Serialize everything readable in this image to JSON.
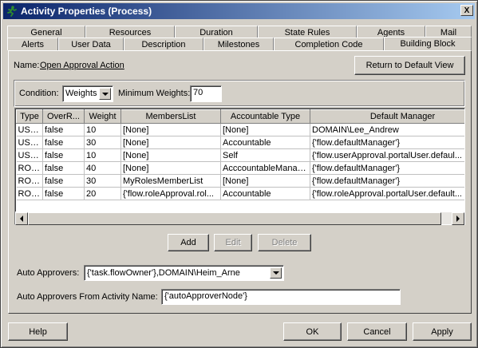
{
  "window": {
    "title": "Activity Properties (Process)",
    "close_glyph": "X"
  },
  "tabs_row1": [
    {
      "label": "General"
    },
    {
      "label": "Resources"
    },
    {
      "label": "Duration"
    },
    {
      "label": "State Rules"
    },
    {
      "label": "Agents"
    },
    {
      "label": "Mail"
    }
  ],
  "tabs_row2": [
    {
      "label": "Alerts"
    },
    {
      "label": "User Data"
    },
    {
      "label": "Description"
    },
    {
      "label": "Milestones"
    },
    {
      "label": "Completion Code"
    },
    {
      "label": "Building Block"
    }
  ],
  "name_label": "Name:",
  "name_value": "Open Approval Action",
  "return_button": "Return to Default View",
  "condition_label": "Condition:",
  "condition_value": "Weights",
  "min_weights_label": "Minimum Weights:",
  "min_weights_value": "70",
  "table": {
    "columns": [
      "Type",
      "OverR...",
      "Weight",
      "MembersList",
      "Accountable Type",
      "Default Manager"
    ],
    "rows": [
      [
        "USER",
        "false",
        "10",
        "[None]",
        "[None]",
        "DOMAIN\\Lee_Andrew"
      ],
      [
        "USER",
        "false",
        "30",
        "[None]",
        "Accountable",
        "{'flow.defaultManager'}"
      ],
      [
        "USER",
        "false",
        "10",
        "[None]",
        "Self",
        "{'flow.userApproval.portalUser.defaul..."
      ],
      [
        "ROLE",
        "false",
        "40",
        "[None]",
        "AcccountableManager",
        "{'flow.defaultManager'}"
      ],
      [
        "ROLE",
        "false",
        "30",
        "MyRolesMemberList",
        "[None]",
        "{'flow.defaultManager'}"
      ],
      [
        "ROLE",
        "false",
        "20",
        "{'flow.roleApproval.rol...",
        "Accountable",
        "{'flow.roleApproval.portalUser.default..."
      ]
    ]
  },
  "add_button": "Add",
  "edit_button": "Edit",
  "delete_button": "Delete",
  "auto_approvers_label": "Auto Approvers:",
  "auto_approvers_value": "{'task.flowOwner'},DOMAIN\\Heim_Arne",
  "auto_approvers_from_label": "Auto Approvers From Activity Name:",
  "auto_approvers_from_value": "{'autoApproverNode'}",
  "footer": {
    "help": "Help",
    "ok": "OK",
    "cancel": "Cancel",
    "apply": "Apply"
  },
  "colors": {
    "titlebar_start": "#0a246a",
    "titlebar_end": "#a6caf0",
    "face": "#d4d0c8",
    "app_icon": "#2e8b2e"
  },
  "icons": [
    "running-figure-icon",
    "close-icon",
    "chevron-down-icon",
    "arrow-left-icon",
    "arrow-right-icon"
  ]
}
